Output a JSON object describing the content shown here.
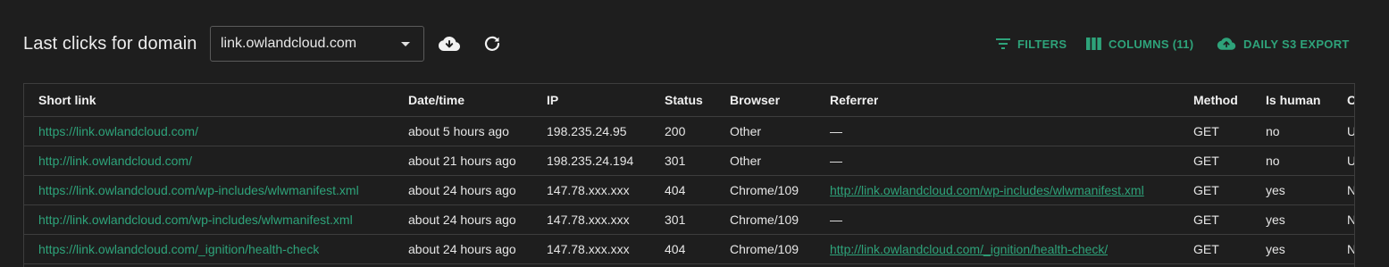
{
  "header": {
    "title": "Last clicks for domain",
    "domain_select": "link.owlandcloud.com"
  },
  "actions": {
    "filters": "FILTERS",
    "columns": "COLUMNS (11)",
    "export": "DAILY S3 EXPORT"
  },
  "table": {
    "columns": [
      "Short link",
      "Date/time",
      "IP",
      "Status",
      "Browser",
      "Referrer",
      "Method",
      "Is human",
      "C"
    ],
    "rows": [
      {
        "short_link": "https://link.owlandcloud.com/",
        "datetime": "about 5 hours ago",
        "ip": "198.235.24.95",
        "status": "200",
        "browser": "Other",
        "referrer": "—",
        "method": "GET",
        "is_human": "no",
        "c": "U"
      },
      {
        "short_link": "http://link.owlandcloud.com/",
        "datetime": "about 21 hours ago",
        "ip": "198.235.24.194",
        "status": "301",
        "browser": "Other",
        "referrer": "—",
        "method": "GET",
        "is_human": "no",
        "c": "U"
      },
      {
        "short_link": "https://link.owlandcloud.com/wp-includes/wlwmanifest.xml",
        "datetime": "about 24 hours ago",
        "ip": "147.78.xxx.xxx",
        "status": "404",
        "browser": "Chrome/109",
        "referrer": "http://link.owlandcloud.com/wp-includes/wlwmanifest.xml",
        "method": "GET",
        "is_human": "yes",
        "c": "N"
      },
      {
        "short_link": "http://link.owlandcloud.com/wp-includes/wlwmanifest.xml",
        "datetime": "about 24 hours ago",
        "ip": "147.78.xxx.xxx",
        "status": "301",
        "browser": "Chrome/109",
        "referrer": "—",
        "method": "GET",
        "is_human": "yes",
        "c": "N"
      },
      {
        "short_link": "https://link.owlandcloud.com/_ignition/health-check",
        "datetime": "about 24 hours ago",
        "ip": "147.78.xxx.xxx",
        "status": "404",
        "browser": "Chrome/109",
        "referrer": "http://link.owlandcloud.com/_ignition/health-check/",
        "method": "GET",
        "is_human": "yes",
        "c": "N"
      }
    ]
  },
  "icons": {
    "download": "cloud-download-icon",
    "refresh": "refresh-icon",
    "filters": "filter-icon",
    "columns": "columns-icon",
    "export": "cloud-upload-icon"
  },
  "colors": {
    "background": "#1e1e1e",
    "accent": "#2ea37a",
    "border": "#3d3d3d",
    "text": "#e6e6e6"
  }
}
